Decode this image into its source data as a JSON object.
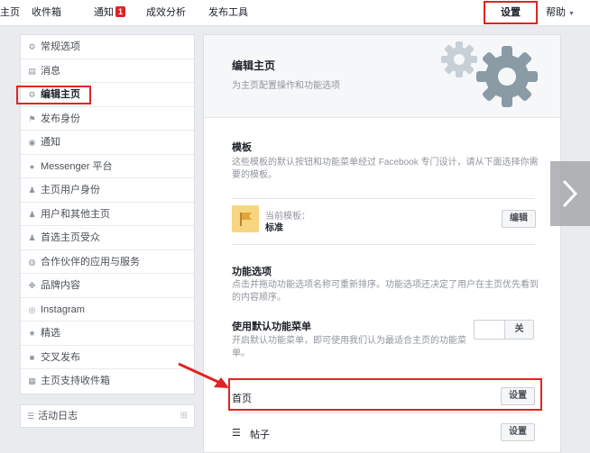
{
  "topnav": {
    "items": [
      "主页",
      "收件箱",
      "通知",
      "成效分析",
      "发布工具"
    ],
    "notification_count": "1",
    "settings": "设置",
    "help": "帮助"
  },
  "sidebar": {
    "items": [
      {
        "label": "常规选项",
        "icon": "gear-icon"
      },
      {
        "label": "消息",
        "icon": "message-icon"
      },
      {
        "label": "编辑主页",
        "icon": "gear-icon"
      },
      {
        "label": "发布身份",
        "icon": "flag-icon"
      },
      {
        "label": "通知",
        "icon": "globe-icon"
      },
      {
        "label": "Messenger 平台",
        "icon": "messenger-icon"
      },
      {
        "label": "主页用户身份",
        "icon": "person-icon"
      },
      {
        "label": "用户和其他主页",
        "icon": "people-icon"
      },
      {
        "label": "首选主页受众",
        "icon": "audience-icon"
      },
      {
        "label": "合作伙伴的应用与服务",
        "icon": "apps-icon"
      },
      {
        "label": "品牌内容",
        "icon": "handshake-icon"
      },
      {
        "label": "Instagram",
        "icon": "instagram-icon"
      },
      {
        "label": "精选",
        "icon": "star-icon"
      },
      {
        "label": "交叉发布",
        "icon": "video-icon"
      },
      {
        "label": "主页支持收件箱",
        "icon": "inbox-icon"
      }
    ],
    "activity_log": "活动日志"
  },
  "main": {
    "title": "编辑主页",
    "subtitle": "为主页配置操作和功能选项",
    "template_section": {
      "title": "模板",
      "desc": "这些模板的默认按钮和功能菜单经过 Facebook 专门设计，请从下面选择你需要的模板。",
      "current_label": "当前模板：",
      "current_value": "标准",
      "edit_button": "编辑"
    },
    "tabs_section": {
      "title": "功能选项",
      "desc": "点击并拖动功能选项名称可重新排序。功能选项还决定了用户在主页优先看到的内容顺序。",
      "default_tabs_title": "使用默认功能菜单",
      "default_tabs_desc": "开启默认功能菜单，即可使用我们认为最适合主页的功能菜单。",
      "toggle_label": "关",
      "tabs": [
        {
          "label": "首页",
          "button": "设置"
        },
        {
          "label": "帖子",
          "button": "设置"
        }
      ]
    }
  },
  "colors": {
    "highlight_red": "#e02424",
    "template_yellow": "#f7d681",
    "gear_gray": "#8a9ba6"
  }
}
